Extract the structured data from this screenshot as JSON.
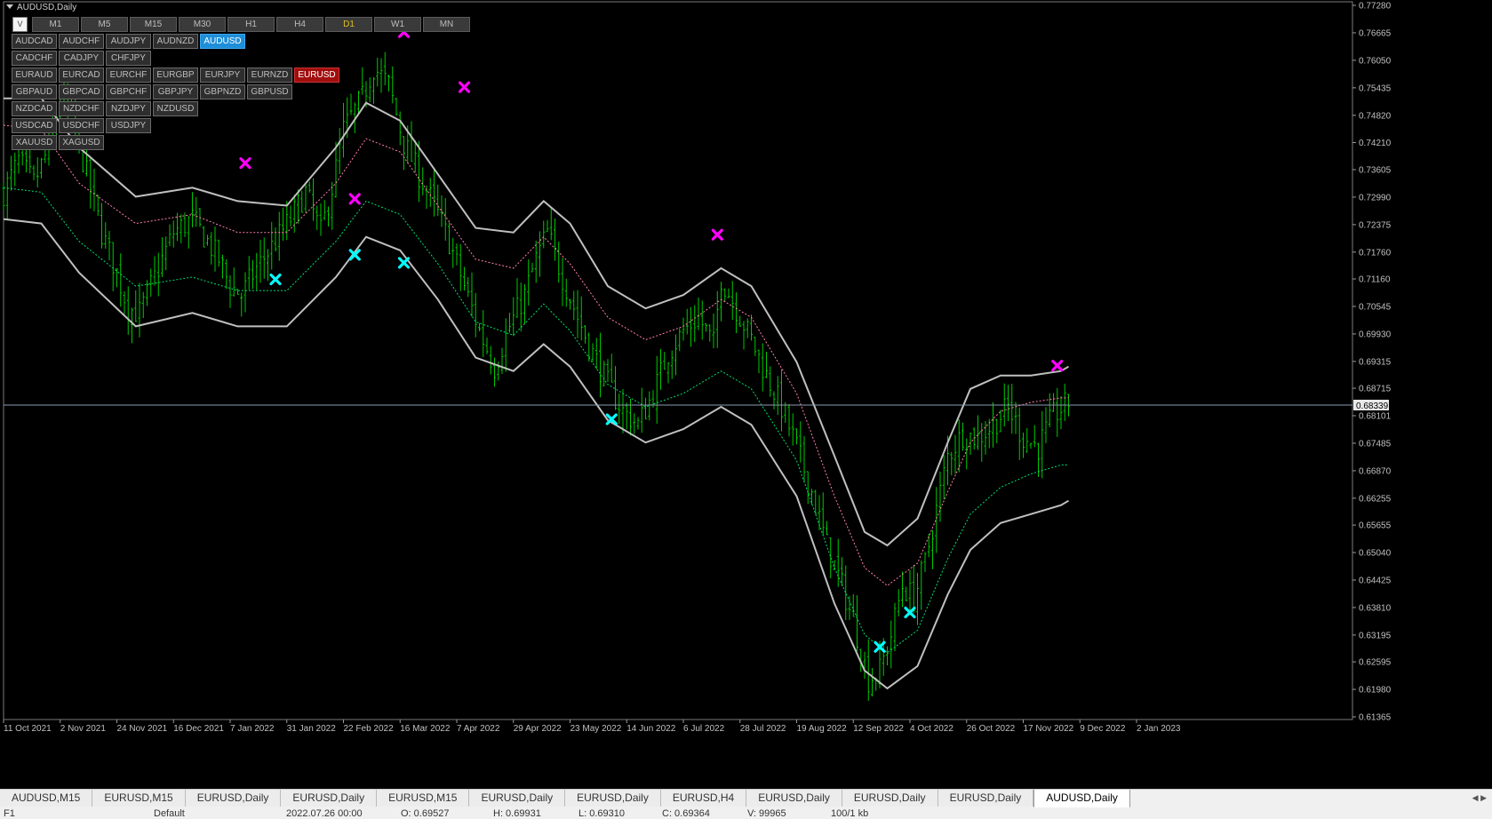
{
  "window": {
    "title": "AUDUSD,Daily"
  },
  "timeframes": {
    "collapse_label": "V",
    "items": [
      "M1",
      "M5",
      "M15",
      "M30",
      "H1",
      "H4",
      "D1",
      "W1",
      "MN"
    ],
    "active": "D1"
  },
  "symbol_rows": [
    [
      "AUDCAD",
      "AUDCHF",
      "AUDJPY",
      "AUDNZD",
      "AUDUSD"
    ],
    [
      "CADCHF",
      "CADJPY",
      "CHFJPY"
    ],
    [
      "EURAUD",
      "EURCAD",
      "EURCHF",
      "EURGBP",
      "EURJPY",
      "EURNZD",
      "EURUSD"
    ],
    [
      "GBPAUD",
      "GBPCAD",
      "GBPCHF",
      "GBPJPY",
      "GBPNZD",
      "GBPUSD"
    ],
    [
      "NZDCAD",
      "NZDCHF",
      "NZDJPY",
      "NZDUSD"
    ],
    [
      "USDCAD",
      "USDCHF",
      "USDJPY"
    ],
    [
      "XAUUSD",
      "XAGUSD"
    ]
  ],
  "symbol_highlight": {
    "AUDUSD": "blue",
    "EURUSD": "red"
  },
  "colors": {
    "background": "#000000",
    "candles": "#00c800",
    "outer_band": "#c0c0c0",
    "upper_dotted": "#ff7fae",
    "lower_dotted": "#00e070",
    "sell_marker": "#ff00ff",
    "buy_marker": "#00ffff",
    "price_line": "#8a9bb0"
  },
  "chart_data": {
    "type": "candlestick",
    "symbol": "AUDUSD",
    "timeframe": "Daily",
    "ylim": [
      0.61365,
      0.7728
    ],
    "y_ticks": [
      "0.77280",
      "0.76665",
      "0.76050",
      "0.75435",
      "0.74820",
      "0.74210",
      "0.73605",
      "0.72990",
      "0.72375",
      "0.71760",
      "0.71160",
      "0.70545",
      "0.69930",
      "0.69315",
      "0.68715",
      "0.68101",
      "0.67485",
      "0.66870",
      "0.66255",
      "0.65655",
      "0.65040",
      "0.64425",
      "0.63810",
      "0.63195",
      "0.62595",
      "0.61980",
      "0.61365"
    ],
    "x_ticks": [
      "11 Oct 2021",
      "2 Nov 2021",
      "24 Nov 2021",
      "16 Dec 2021",
      "7 Jan 2022",
      "31 Jan 2022",
      "22 Feb 2022",
      "16 Mar 2022",
      "7 Apr 2022",
      "29 Apr 2022",
      "23 May 2022",
      "14 Jun 2022",
      "6 Jul 2022",
      "28 Jul 2022",
      "19 Aug 2022",
      "12 Sep 2022",
      "4 Oct 2022",
      "26 Oct 2022",
      "17 Nov 2022",
      "9 Dec 2022",
      "2 Jan 2023"
    ],
    "current_price": "0.68339",
    "close_path": [
      [
        0,
        0.731
      ],
      [
        4,
        0.738
      ],
      [
        8,
        0.733
      ],
      [
        12,
        0.741
      ],
      [
        15,
        0.752
      ],
      [
        18,
        0.748
      ],
      [
        22,
        0.735
      ],
      [
        26,
        0.722
      ],
      [
        30,
        0.713
      ],
      [
        33,
        0.705
      ],
      [
        36,
        0.704
      ],
      [
        40,
        0.712
      ],
      [
        45,
        0.722
      ],
      [
        50,
        0.725
      ],
      [
        54,
        0.72
      ],
      [
        57,
        0.716
      ],
      [
        60,
        0.71
      ],
      [
        63,
        0.708
      ],
      [
        67,
        0.714
      ],
      [
        72,
        0.72
      ],
      [
        76,
        0.725
      ],
      [
        80,
        0.731
      ],
      [
        84,
        0.722
      ],
      [
        87,
        0.732
      ],
      [
        90,
        0.745
      ],
      [
        95,
        0.752
      ],
      [
        98,
        0.759
      ],
      [
        102,
        0.755
      ],
      [
        106,
        0.742
      ],
      [
        110,
        0.735
      ],
      [
        114,
        0.728
      ],
      [
        118,
        0.72
      ],
      [
        122,
        0.71
      ],
      [
        126,
        0.7
      ],
      [
        130,
        0.692
      ],
      [
        134,
        0.701
      ],
      [
        138,
        0.708
      ],
      [
        141,
        0.716
      ],
      [
        144,
        0.722
      ],
      [
        148,
        0.712
      ],
      [
        152,
        0.703
      ],
      [
        156,
        0.695
      ],
      [
        160,
        0.688
      ],
      [
        164,
        0.682
      ],
      [
        168,
        0.679
      ],
      [
        172,
        0.686
      ],
      [
        176,
        0.695
      ],
      [
        180,
        0.7
      ],
      [
        184,
        0.703
      ],
      [
        188,
        0.697
      ],
      [
        190,
        0.712
      ],
      [
        194,
        0.705
      ],
      [
        198,
        0.698
      ],
      [
        202,
        0.69
      ],
      [
        206,
        0.683
      ],
      [
        210,
        0.674
      ],
      [
        214,
        0.664
      ],
      [
        218,
        0.652
      ],
      [
        222,
        0.643
      ],
      [
        226,
        0.632
      ],
      [
        229,
        0.622
      ],
      [
        232,
        0.624
      ],
      [
        235,
        0.632
      ],
      [
        238,
        0.643
      ],
      [
        241,
        0.64
      ],
      [
        244,
        0.648
      ],
      [
        247,
        0.66
      ],
      [
        250,
        0.672
      ],
      [
        254,
        0.677
      ],
      [
        258,
        0.676
      ],
      [
        262,
        0.679
      ],
      [
        266,
        0.683
      ],
      [
        270,
        0.676
      ],
      [
        274,
        0.674
      ],
      [
        278,
        0.681
      ],
      [
        282,
        0.684
      ]
    ],
    "indicator_bands": {
      "outer_upper": [
        [
          0,
          0.752
        ],
        [
          10,
          0.752
        ],
        [
          20,
          0.741
        ],
        [
          35,
          0.73
        ],
        [
          50,
          0.732
        ],
        [
          62,
          0.729
        ],
        [
          75,
          0.728
        ],
        [
          88,
          0.741
        ],
        [
          96,
          0.751
        ],
        [
          105,
          0.747
        ],
        [
          115,
          0.735
        ],
        [
          125,
          0.723
        ],
        [
          135,
          0.722
        ],
        [
          143,
          0.729
        ],
        [
          150,
          0.724
        ],
        [
          160,
          0.71
        ],
        [
          170,
          0.705
        ],
        [
          180,
          0.708
        ],
        [
          190,
          0.714
        ],
        [
          198,
          0.71
        ],
        [
          210,
          0.693
        ],
        [
          220,
          0.672
        ],
        [
          228,
          0.655
        ],
        [
          234,
          0.652
        ],
        [
          242,
          0.658
        ],
        [
          250,
          0.675
        ],
        [
          256,
          0.687
        ],
        [
          264,
          0.69
        ],
        [
          272,
          0.69
        ],
        [
          280,
          0.691
        ],
        [
          282,
          0.692
        ]
      ],
      "upper_dotted": [
        [
          0,
          0.746
        ],
        [
          10,
          0.745
        ],
        [
          20,
          0.733
        ],
        [
          35,
          0.724
        ],
        [
          50,
          0.726
        ],
        [
          62,
          0.722
        ],
        [
          75,
          0.722
        ],
        [
          88,
          0.733
        ],
        [
          96,
          0.743
        ],
        [
          105,
          0.74
        ],
        [
          115,
          0.728
        ],
        [
          125,
          0.716
        ],
        [
          135,
          0.714
        ],
        [
          143,
          0.721
        ],
        [
          150,
          0.715
        ],
        [
          160,
          0.703
        ],
        [
          170,
          0.698
        ],
        [
          180,
          0.701
        ],
        [
          190,
          0.707
        ],
        [
          198,
          0.703
        ],
        [
          210,
          0.686
        ],
        [
          220,
          0.663
        ],
        [
          228,
          0.647
        ],
        [
          234,
          0.643
        ],
        [
          242,
          0.648
        ],
        [
          250,
          0.664
        ],
        [
          256,
          0.675
        ],
        [
          264,
          0.682
        ],
        [
          272,
          0.684
        ],
        [
          280,
          0.685
        ],
        [
          282,
          0.685
        ]
      ],
      "lower_dotted": [
        [
          0,
          0.732
        ],
        [
          10,
          0.731
        ],
        [
          20,
          0.72
        ],
        [
          35,
          0.71
        ],
        [
          50,
          0.712
        ],
        [
          62,
          0.709
        ],
        [
          75,
          0.709
        ],
        [
          88,
          0.72
        ],
        [
          96,
          0.729
        ],
        [
          105,
          0.726
        ],
        [
          115,
          0.715
        ],
        [
          125,
          0.702
        ],
        [
          135,
          0.699
        ],
        [
          143,
          0.706
        ],
        [
          150,
          0.7
        ],
        [
          160,
          0.688
        ],
        [
          170,
          0.683
        ],
        [
          180,
          0.686
        ],
        [
          190,
          0.691
        ],
        [
          198,
          0.687
        ],
        [
          210,
          0.671
        ],
        [
          220,
          0.647
        ],
        [
          228,
          0.632
        ],
        [
          234,
          0.628
        ],
        [
          242,
          0.633
        ],
        [
          250,
          0.649
        ],
        [
          256,
          0.659
        ],
        [
          264,
          0.665
        ],
        [
          272,
          0.668
        ],
        [
          280,
          0.67
        ],
        [
          282,
          0.67
        ]
      ],
      "outer_lower": [
        [
          0,
          0.725
        ],
        [
          10,
          0.724
        ],
        [
          20,
          0.713
        ],
        [
          35,
          0.701
        ],
        [
          50,
          0.704
        ],
        [
          62,
          0.701
        ],
        [
          75,
          0.701
        ],
        [
          88,
          0.712
        ],
        [
          96,
          0.721
        ],
        [
          105,
          0.718
        ],
        [
          115,
          0.707
        ],
        [
          125,
          0.694
        ],
        [
          135,
          0.691
        ],
        [
          143,
          0.697
        ],
        [
          150,
          0.692
        ],
        [
          160,
          0.68
        ],
        [
          170,
          0.675
        ],
        [
          180,
          0.678
        ],
        [
          190,
          0.683
        ],
        [
          198,
          0.679
        ],
        [
          210,
          0.663
        ],
        [
          220,
          0.639
        ],
        [
          228,
          0.624
        ],
        [
          234,
          0.62
        ],
        [
          242,
          0.625
        ],
        [
          250,
          0.641
        ],
        [
          256,
          0.651
        ],
        [
          264,
          0.657
        ],
        [
          272,
          0.659
        ],
        [
          280,
          0.661
        ],
        [
          282,
          0.662
        ]
      ]
    },
    "sell_signals": [
      [
        64,
        0.7375
      ],
      [
        93,
        0.7295
      ],
      [
        106,
        0.7668
      ],
      [
        122,
        0.7545
      ],
      [
        189,
        0.7215
      ],
      [
        279,
        0.6922
      ]
    ],
    "buy_signals": [
      [
        72,
        0.7115
      ],
      [
        93,
        0.717
      ],
      [
        106,
        0.7152
      ],
      [
        161,
        0.6802
      ],
      [
        232,
        0.6293
      ],
      [
        240,
        0.637
      ]
    ]
  },
  "tabs": {
    "items": [
      "AUDUSD,M15",
      "EURUSD,M15",
      "EURUSD,Daily",
      "EURUSD,Daily",
      "EURUSD,M15",
      "EURUSD,Daily",
      "EURUSD,Daily",
      "EURUSD,H4",
      "EURUSD,Daily",
      "EURUSD,Daily",
      "EURUSD,Daily",
      "AUDUSD,Daily"
    ],
    "active_index": 11,
    "scroll_arrows": "◀ ▶"
  },
  "status_bar": [
    "F1",
    "Default",
    "2022.07.26 00:00",
    "O: 0.69527",
    "H: 0.69931",
    "L: 0.69310",
    "C: 0.69364",
    "V: 99965",
    "100/1 kb"
  ]
}
